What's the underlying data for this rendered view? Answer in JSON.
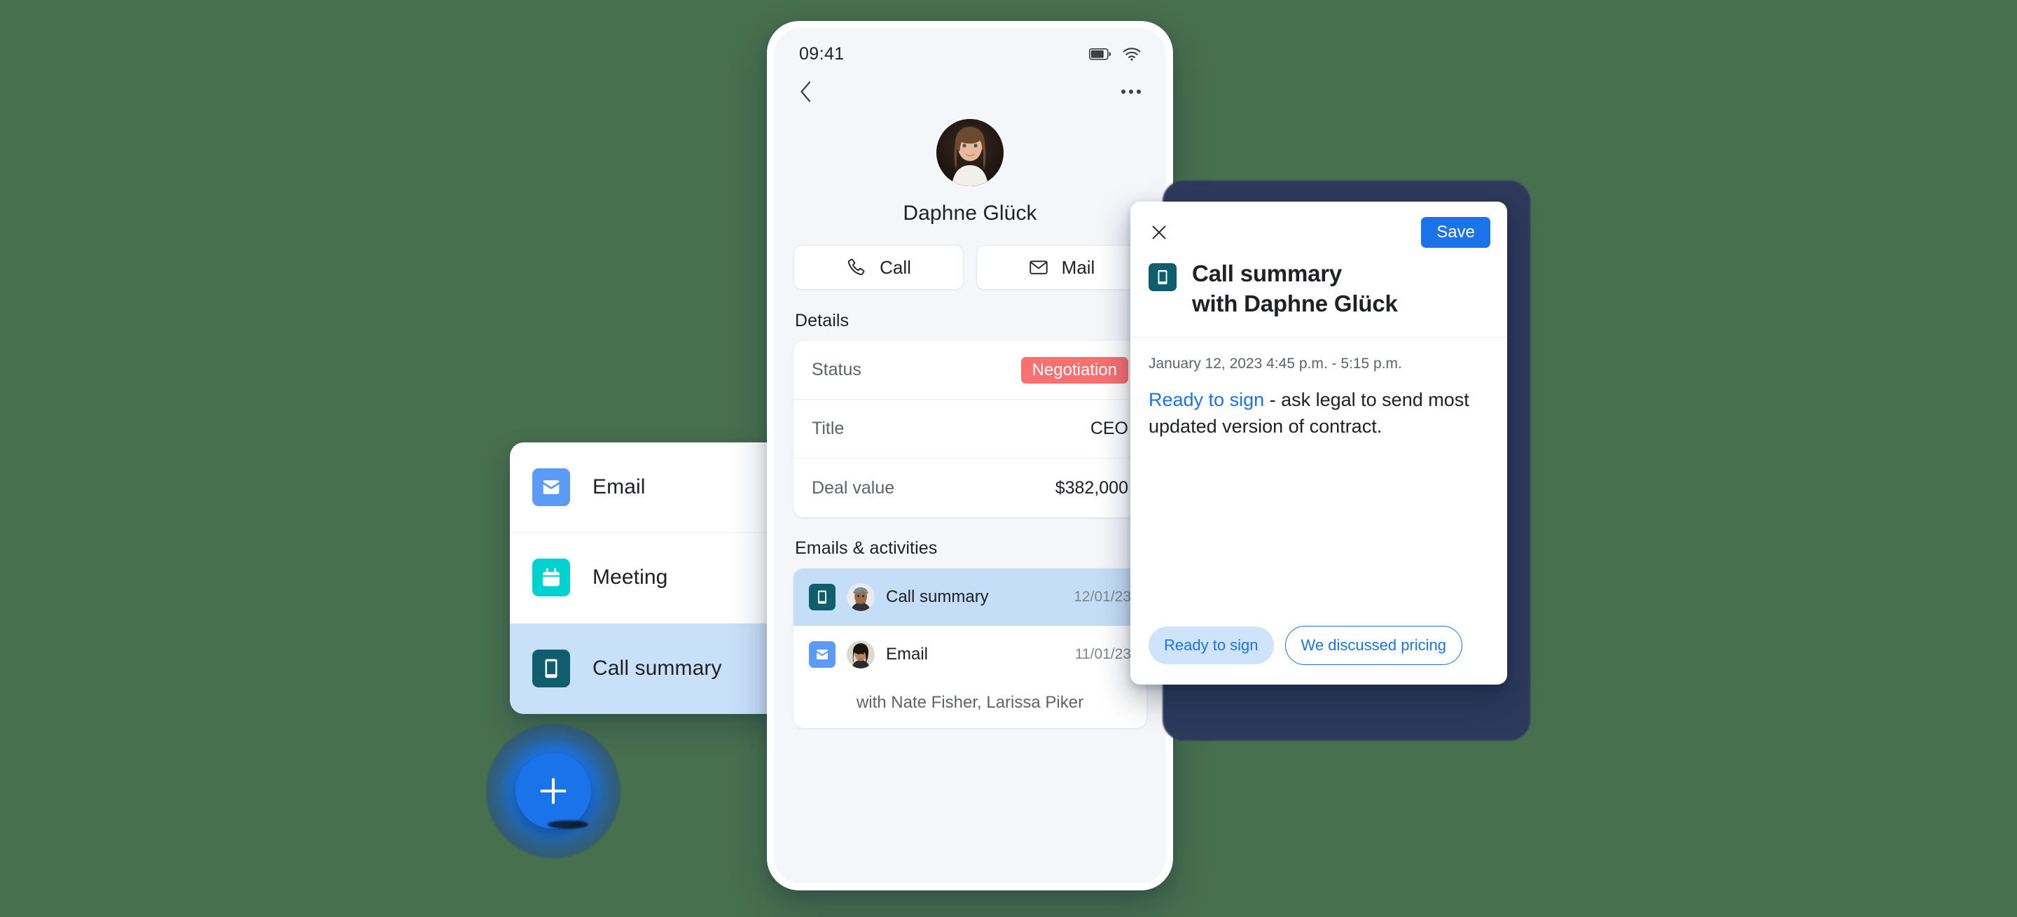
{
  "background_color": "#47704e",
  "menu_panel": {
    "items": [
      {
        "label": "Email",
        "icon": "envelope-icon",
        "color": "#5b9bf5",
        "selected": false
      },
      {
        "label": "Meeting",
        "icon": "calendar-icon",
        "color": "#00d2d2",
        "selected": false
      },
      {
        "label": "Call summary",
        "icon": "smartphone-icon",
        "color": "#0f5e6e",
        "selected": true
      }
    ]
  },
  "fab": {
    "icon": "plus-icon",
    "color": "#1a73e8"
  },
  "phone": {
    "status_bar": {
      "time": "09:41",
      "battery_icon": "battery-icon",
      "wifi_icon": "wifi-icon"
    },
    "nav": {
      "back_icon": "chevron-left-icon",
      "more_icon": "more-horizontal-icon"
    },
    "profile": {
      "name": "Daphne Glück",
      "avatar": "contact-avatar"
    },
    "actions": [
      {
        "label": "Call",
        "icon": "phone-icon"
      },
      {
        "label": "Mail",
        "icon": "envelope-outline-icon"
      }
    ],
    "details": {
      "heading": "Details",
      "rows": [
        {
          "label": "Status",
          "value": "Negotiation",
          "badge": true,
          "badge_color": "#f87171"
        },
        {
          "label": "Title",
          "value": "CEO",
          "badge": false
        },
        {
          "label": "Deal value",
          "value": "$382,000",
          "badge": false
        }
      ]
    },
    "activities": {
      "heading": "Emails & activities",
      "rows": [
        {
          "title": "Call summary",
          "date": "12/01/23",
          "icon": "smartphone-icon",
          "icon_color": "#0f5e6e",
          "selected": true
        },
        {
          "title": "Email",
          "date": "11/01/23",
          "icon": "envelope-icon",
          "icon_color": "#5b9bf5",
          "selected": false
        }
      ],
      "subtitle": "with Nate Fisher, Larissa Piker"
    }
  },
  "summary_card": {
    "close_icon": "close-icon",
    "save_label": "Save",
    "type_icon": "smartphone-icon",
    "title_line1": "Call summary",
    "title_line2": "with Daphne Glück",
    "datetime": "January 12, 2023  4:45 p.m. - 5:15 p.m.",
    "body_highlight": "Ready to sign",
    "body_rest": " - ask legal to send most updated version of contract.",
    "chips": [
      {
        "label": "Ready to sign",
        "style": "filled"
      },
      {
        "label": "We discussed pricing",
        "style": "outline"
      }
    ],
    "accent_color": "#1a73e8"
  }
}
